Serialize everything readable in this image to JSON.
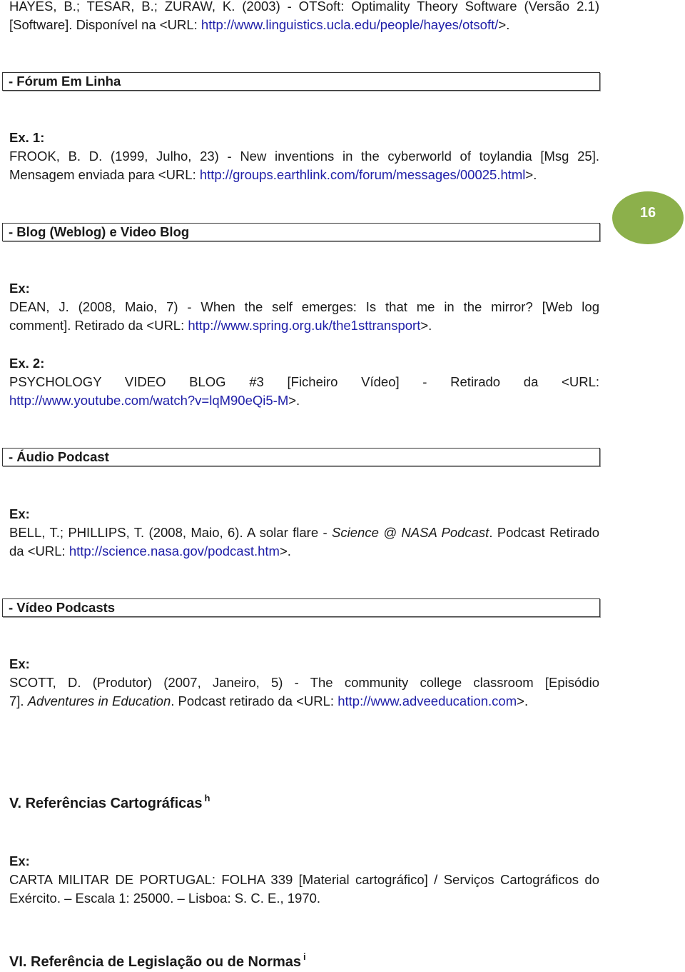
{
  "page_number": "16",
  "colors": {
    "link": "#1f1fa8",
    "badge": "#8cb04b"
  },
  "top_ref": {
    "line1": "HAYES, B.; TESAR, B.; ZURAW, K. (2003) - OTSoft: Optimality Theory Software (Versão 2.1)",
    "line2_prefix": "[Software]. Disponível na <URL: ",
    "line2_link": "http://www.linguistics.ucla.edu/people/hayes/otsoft/",
    "line2_suffix": ">."
  },
  "sections": {
    "forum": {
      "title": "- Fórum Em Linha",
      "ex_label": "Ex. 1:",
      "line1": "FROOK, B. D. (1999, Julho, 23) - New inventions in the cyberworld of toylandia [Msg 25].",
      "line2_prefix": "Mensagem enviada para <URL: ",
      "line2_link": "http://groups.earthlink.com/forum/messages/00025.html",
      "line2_suffix": ">."
    },
    "blog": {
      "title": "- Blog (Weblog) e Video Blog",
      "ex1_label": "Ex:",
      "ex1_line1": "DEAN, J. (2008, Maio, 7) - When the self emerges: Is that me in the mirror? [Web log",
      "ex1_line2_prefix": "comment]. Retirado da <URL: ",
      "ex1_line2_link": "http://www.spring.org.uk/the1sttransport",
      "ex1_line2_suffix": ">.",
      "ex2_label": "Ex. 2:",
      "ex2_line1": "PSYCHOLOGY VIDEO BLOG #3 [Ficheiro Vídeo] - Retirado da <URL:",
      "ex2_line2_link": "http://www.youtube.com/watch?v=lqM90eQi5-M",
      "ex2_line2_suffix": ">."
    },
    "audio": {
      "title": "- Áudio Podcast",
      "ex_label": "Ex:",
      "line1_prefix": "BELL, T.; PHILLIPS, T. (2008, Maio, 6). A solar flare - ",
      "line1_italic": "Science @ NASA Podcast",
      "line1_suffix": ". Podcast Retirado",
      "line2_prefix": "da <URL: ",
      "line2_link": "http://science.nasa.gov/podcast.htm",
      "line2_suffix": ">."
    },
    "video": {
      "title": "- Vídeo Podcasts",
      "ex_label": "Ex:",
      "line1": "SCOTT, D. (Produtor) (2007, Janeiro, 5) - The community college classroom [Episódio",
      "line2_prefix": "7]. ",
      "line2_italic": "Adventures in Education",
      "line2_middle": ". Podcast retirado da <URL: ",
      "line2_link": "http://www.adveeducation.com",
      "line2_suffix": ">."
    }
  },
  "cartographic": {
    "heading": "V. Referências Cartográficas",
    "footnote": "h",
    "ex_label": "Ex:",
    "line1": "CARTA MILITAR DE PORTUGAL: FOLHA 339 [Material cartográfico] / Serviços Cartográficos do",
    "line2": "Exército. – Escala 1: 25000. – Lisboa: S. C. E., 1970."
  },
  "legislation": {
    "heading": "VI. Referência de Legislação ou de Normas",
    "footnote": "i"
  }
}
